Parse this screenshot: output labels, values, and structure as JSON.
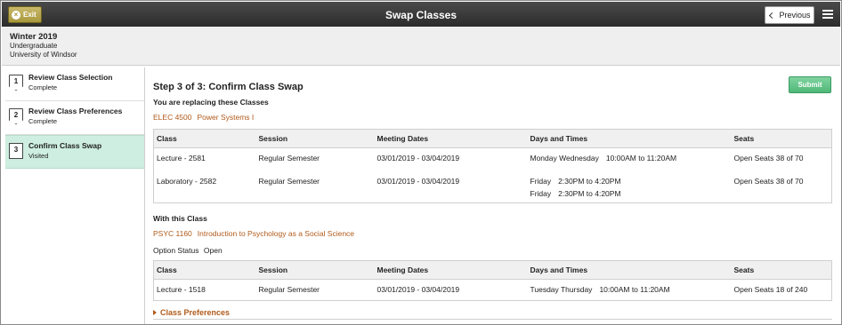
{
  "header": {
    "exit_label": "Exit",
    "title": "Swap Classes",
    "previous_label": "Previous"
  },
  "term": {
    "name": "Winter 2019",
    "career": "Undergraduate",
    "institution": "University of Windsor"
  },
  "steps": [
    {
      "num": "1",
      "title": "Review Class Selection",
      "status": "Complete"
    },
    {
      "num": "2",
      "title": "Review Class Preferences",
      "status": "Complete"
    },
    {
      "num": "3",
      "title": "Confirm Class Swap",
      "status": "Visited"
    }
  ],
  "main": {
    "heading": "Step 3 of 3: Confirm Class Swap",
    "submit_label": "Submit",
    "replacing_label": "You are replacing these Classes",
    "replace_course_code": "ELEC 4500",
    "replace_course_title": "Power Systems I",
    "with_label": "With this Class",
    "with_course_code": "PSYC 1160",
    "with_course_title": "Introduction to Psychology as a Social Science",
    "option_status_label": "Option Status",
    "option_status_value": "Open",
    "class_preferences_label": "Class Preferences"
  },
  "columns": [
    "Class",
    "Session",
    "Meeting Dates",
    "Days and Times",
    "Seats"
  ],
  "replace_rows": [
    {
      "class": "Lecture - 2581",
      "session": "Regular Semester",
      "dates": "03/01/2019 - 03/04/2019",
      "days1": "Monday Wednesday",
      "time1": "10:00AM to 11:20AM",
      "seats": "Open Seats 38 of 70"
    },
    {
      "class": "Laboratory - 2582",
      "session": "Regular Semester",
      "dates": "03/01/2019 - 03/04/2019",
      "days1": "Friday",
      "time1": "2:30PM to 4:20PM",
      "days2": "Friday",
      "time2": "2:30PM to 4:20PM",
      "seats": "Open Seats 38 of 70"
    }
  ],
  "with_rows": [
    {
      "class": "Lecture - 1518",
      "session": "Regular Semester",
      "dates": "03/01/2019 - 03/04/2019",
      "days1": "Tuesday Thursday",
      "time1": "10:00AM to 11:20AM",
      "seats": "Open Seats 18 of 240"
    }
  ],
  "colors": {
    "accent_green": "#4fb878",
    "link_orange": "#b05a1a",
    "active_step_bg": "#cdeee0"
  }
}
